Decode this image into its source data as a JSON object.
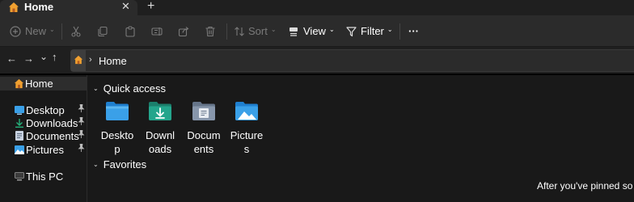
{
  "tab": {
    "title": "Home",
    "close": "✕",
    "new_tab": "+"
  },
  "toolbar": {
    "new_label": "New",
    "sort_label": "Sort",
    "view_label": "View",
    "filter_label": "Filter",
    "more": "···",
    "icons": [
      "cut-icon",
      "copy-icon",
      "paste-icon",
      "rename-icon",
      "share-icon",
      "delete-icon"
    ]
  },
  "nav": {
    "back": "←",
    "forward": "→",
    "recent": "⌄",
    "up": "↑"
  },
  "address": {
    "separator": "›",
    "path": "Home"
  },
  "sidebar": {
    "home": "Home",
    "items": [
      {
        "label": "Desktop",
        "icon": "desktop-icon",
        "pinned": true
      },
      {
        "label": "Downloads",
        "icon": "downloads-icon",
        "pinned": true
      },
      {
        "label": "Documents",
        "icon": "documents-icon",
        "pinned": true
      },
      {
        "label": "Pictures",
        "icon": "pictures-icon",
        "pinned": true
      }
    ],
    "this_pc": "This PC",
    "pin_glyph": "📌"
  },
  "main": {
    "quick_access": "Quick access",
    "tiles": [
      {
        "line1": "Deskto",
        "line2": "p",
        "icon": "desktop-folder-icon"
      },
      {
        "line1": "Downl",
        "line2": "oads",
        "icon": "downloads-folder-icon"
      },
      {
        "line1": "Docum",
        "line2": "ents",
        "icon": "documents-folder-icon"
      },
      {
        "line1": "Picture",
        "line2": "s",
        "icon": "pictures-folder-icon"
      }
    ],
    "favorites": "Favorites",
    "favorites_message": "After you've pinned so"
  },
  "colors": {
    "background": "#191919",
    "toolbar": "#2b2b2b",
    "accent_home": "#f0a030",
    "folder_blue": "#3aa0e8",
    "folder_teal": "#24a58c",
    "folder_slate": "#8796ab"
  }
}
